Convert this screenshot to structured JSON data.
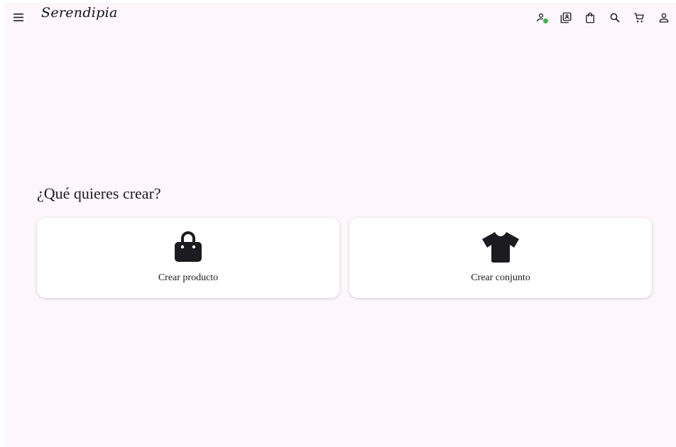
{
  "app": {
    "logo_text": "Serendipia"
  },
  "topbar": {
    "icons": [
      "menu-icon",
      "add-user-icon",
      "photo-album-icon",
      "shopping-bag-icon",
      "search-icon",
      "cart-icon",
      "account-icon"
    ],
    "badge_color": "#3fb350"
  },
  "main": {
    "title": "¿Qué quieres crear?",
    "options": [
      {
        "label": "Crear producto",
        "icon": "shopping-bag-icon"
      },
      {
        "label": "Crear conjunto",
        "icon": "tshirt-icon"
      }
    ]
  },
  "colors": {
    "background": "#fdf7fc",
    "card": "#ffffff",
    "text": "#1c1b1f"
  }
}
